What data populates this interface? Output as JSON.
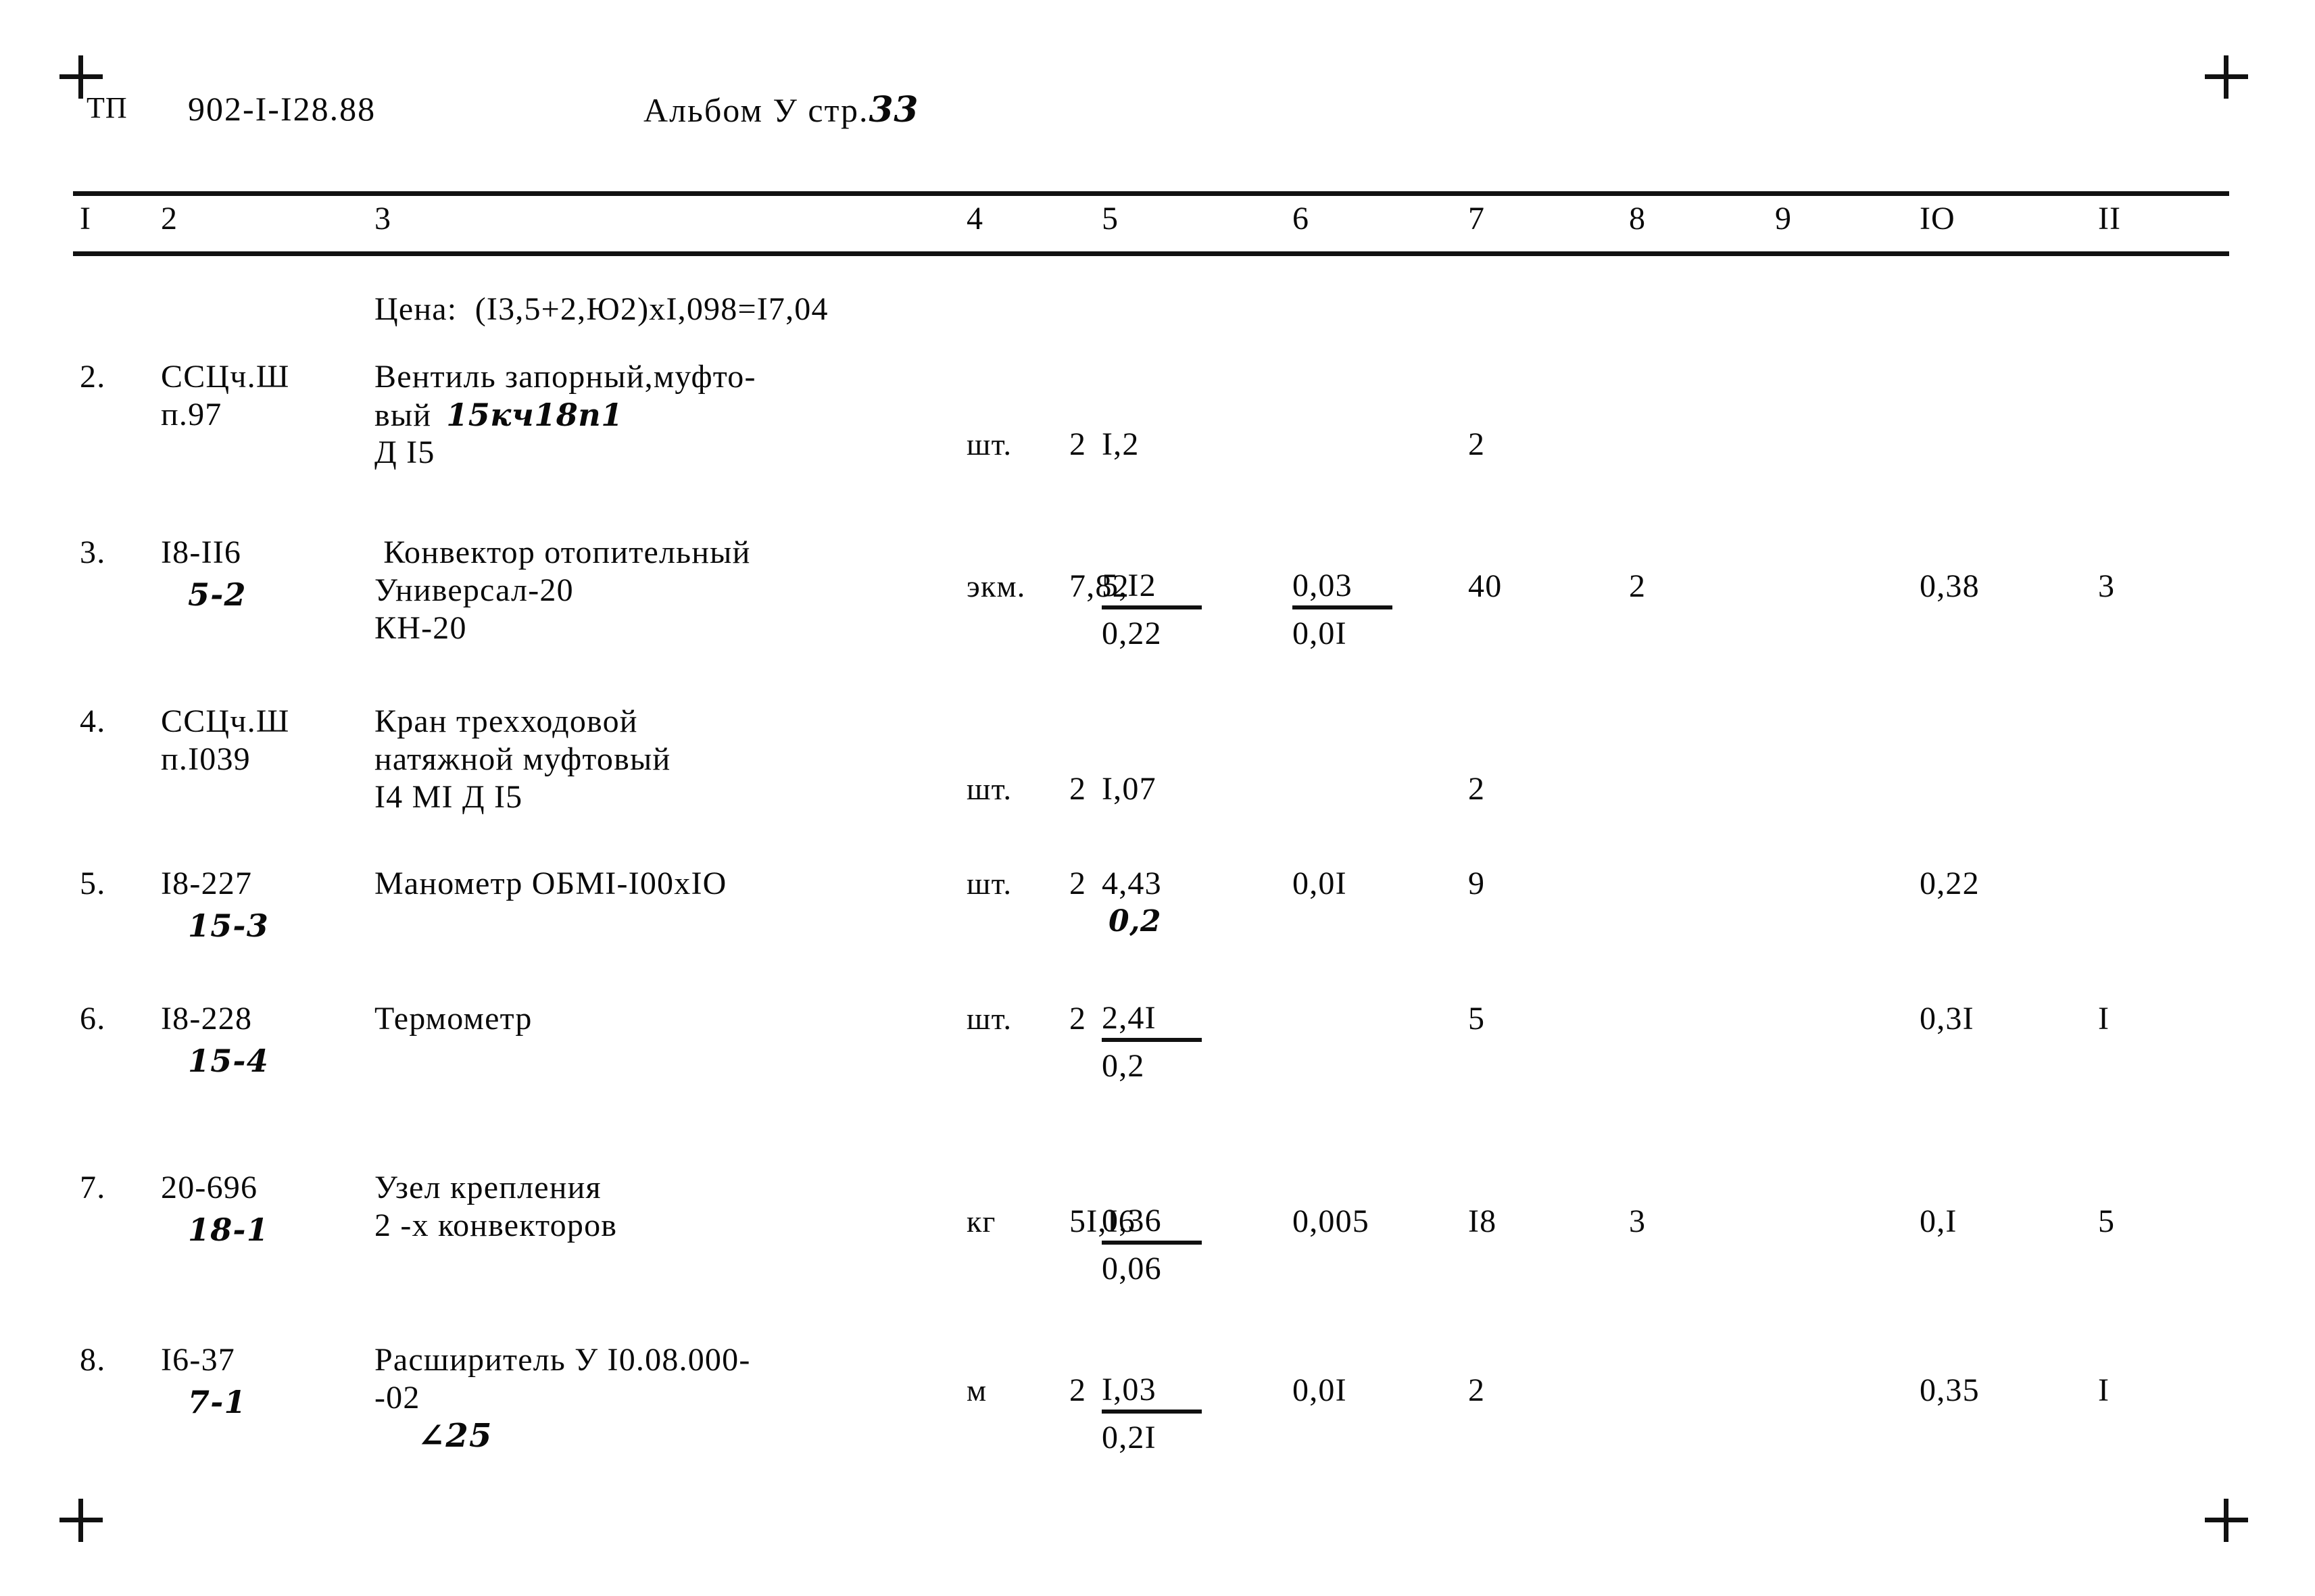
{
  "header": {
    "tp_label": "ТП",
    "document_code": "902-I-I28.88",
    "album_label": "Альбом  У  стр.",
    "page_number_hand": "33"
  },
  "table": {
    "column_headers": [
      "I",
      "2",
      "3",
      "4",
      "5",
      "6",
      "7",
      "8",
      "9",
      "IO",
      "II"
    ],
    "price_note": "Цена:  (I3,5+2,Ю2)xI,098=I7,04",
    "rows": [
      {
        "no": "2.",
        "code": "ССЦч.Ш",
        "code2": "п.97",
        "code_hand": "",
        "desc1": "Вентиль запорный,муфто-",
        "desc2": "вый",
        "desc2_hand": "15кч18п1",
        "desc3": "Д I5",
        "unit": "шт.",
        "qty": "2",
        "c5_num": "I,2",
        "c5_den": "",
        "c5_bar": false,
        "c6_num": "",
        "c6_den": "",
        "c6_bar": false,
        "c7": "2",
        "c8": "",
        "c9": "",
        "c10": "",
        "c11": ""
      },
      {
        "no": "3.",
        "code": "I8-II6",
        "code2": "",
        "code_hand": "5-2",
        "desc1": " Конвектор отопительный",
        "desc2": "Универсал-20",
        "desc2_hand": "",
        "desc3": "КН-20",
        "unit": "экм.",
        "qty": "7,82",
        "c5_num": "5,I2",
        "c5_den": "0,22",
        "c5_bar": true,
        "c6_num": "0,03",
        "c6_den": "0,0I",
        "c6_bar": true,
        "c7": "40",
        "c8": "2",
        "c9": "",
        "c10": "0,38",
        "c11": "3"
      },
      {
        "no": "4.",
        "code": "ССЦч.Ш",
        "code2": "п.I039",
        "code_hand": "",
        "desc1": "Кран трехходовой",
        "desc2": "натяжной муфтовый",
        "desc2_hand": "",
        "desc3": "I4 МI Д I5",
        "unit": "шт.",
        "qty": "2",
        "c5_num": "I,07",
        "c5_den": "",
        "c5_bar": false,
        "c6_num": "",
        "c6_den": "",
        "c6_bar": false,
        "c7": "2",
        "c8": "",
        "c9": "",
        "c10": "",
        "c11": ""
      },
      {
        "no": "5.",
        "code": "I8-227",
        "code2": "",
        "code_hand": "15-3",
        "desc1": "Манометр ОБМI-I00xIO",
        "desc2": "",
        "desc2_hand": "",
        "desc3": "",
        "unit": "шт.",
        "qty": "2",
        "c5_num": "4,43",
        "c5_den": "0,2",
        "c5_bar": false,
        "c5_den_hand": true,
        "c6_num": "0,0I",
        "c6_den": "",
        "c6_bar": false,
        "c7": "9",
        "c8": "",
        "c9": "",
        "c10": "0,22",
        "c11": ""
      },
      {
        "no": "6.",
        "code": "I8-228",
        "code2": "",
        "code_hand": "15-4",
        "desc1": "Термометр",
        "desc2": "",
        "desc2_hand": "",
        "desc3": "",
        "unit": "шт.",
        "qty": "2",
        "c5_num": "2,4I",
        "c5_den": "0,2",
        "c5_bar": true,
        "c6_num": "",
        "c6_den": "",
        "c6_bar": false,
        "c7": "5",
        "c8": "",
        "c9": "",
        "c10": "0,3I",
        "c11": "I"
      },
      {
        "no": "7.",
        "code": "20-696",
        "code2": "",
        "code_hand": "18-1",
        "desc1": "Узел крепления",
        "desc2": "2 -х конвекторов",
        "desc2_hand": "",
        "desc3": "",
        "unit": "кг",
        "qty": "5I,I6",
        "c5_num": "0,36",
        "c5_den": "0,06",
        "c5_bar": true,
        "c6_num": "0,005",
        "c6_den": "",
        "c6_bar": false,
        "c7": "I8",
        "c8": "3",
        "c9": "",
        "c10": "0,I",
        "c11": "5"
      },
      {
        "no": "8.",
        "code": "I6-37",
        "code2": "",
        "code_hand": "7-1",
        "desc1": "Расширитель У I0.08.000-",
        "desc2": "-02",
        "desc2_hand": "",
        "desc3": "",
        "desc3_hand": "∠25",
        "unit": "м",
        "qty": "2",
        "c5_num": "I,03",
        "c5_den": "0,2I",
        "c5_bar": true,
        "c6_num": "0,0I",
        "c6_den": "",
        "c6_bar": false,
        "c7": "2",
        "c8": "",
        "c9": "",
        "c10": "0,35",
        "c11": "I"
      }
    ]
  }
}
